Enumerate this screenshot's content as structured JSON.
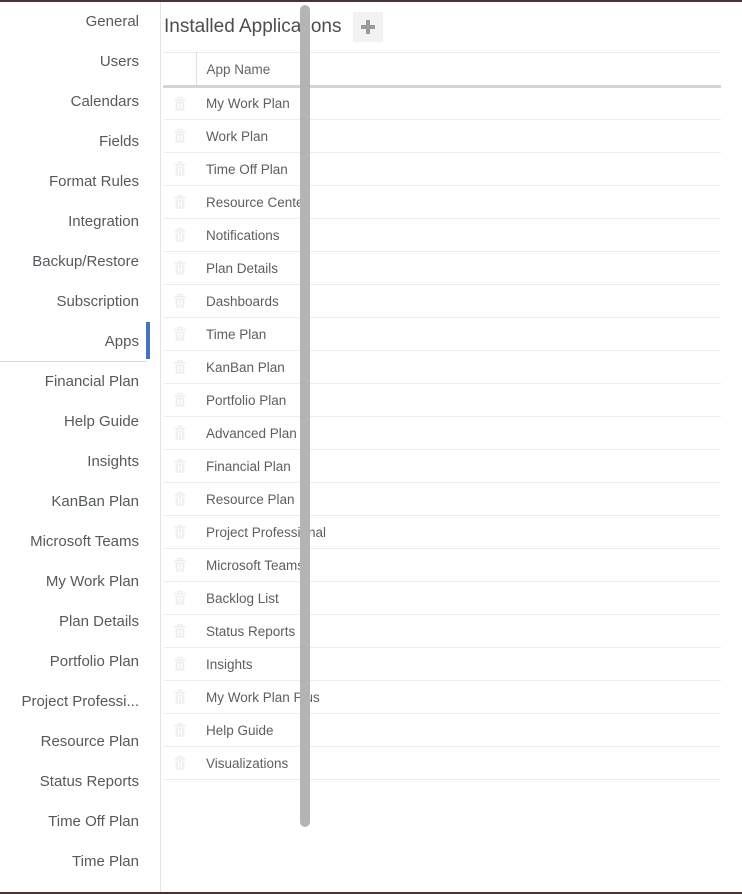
{
  "colors": {
    "active_marker": "#4472c4",
    "nav_text": "#555a5e",
    "title_text": "#4d4d4d",
    "row_text": "#5a5f63",
    "header_text": "#656565",
    "scrollbar_thumb": "#b4b4b4",
    "add_button_bg": "#f2f2f2",
    "add_button_glyph": "#9a9a9a",
    "trash_icon": "#f0f0f0",
    "row_divider": "#ededed",
    "header_divider": "#d4d4d4"
  },
  "sidebar": {
    "active_item": "Apps",
    "items": [
      {
        "label": "General",
        "active": false,
        "group_end": false
      },
      {
        "label": "Users",
        "active": false,
        "group_end": false
      },
      {
        "label": "Calendars",
        "active": false,
        "group_end": false
      },
      {
        "label": "Fields",
        "active": false,
        "group_end": false
      },
      {
        "label": "Format Rules",
        "active": false,
        "group_end": false
      },
      {
        "label": "Integration",
        "active": false,
        "group_end": false
      },
      {
        "label": "Backup/Restore",
        "active": false,
        "group_end": false
      },
      {
        "label": "Subscription",
        "active": false,
        "group_end": false
      },
      {
        "label": "Apps",
        "active": true,
        "group_end": true
      },
      {
        "label": "Financial Plan",
        "active": false,
        "group_end": false
      },
      {
        "label": "Help Guide",
        "active": false,
        "group_end": false
      },
      {
        "label": "Insights",
        "active": false,
        "group_end": false
      },
      {
        "label": "KanBan Plan",
        "active": false,
        "group_end": false
      },
      {
        "label": "Microsoft Teams",
        "active": false,
        "group_end": false
      },
      {
        "label": "My Work Plan",
        "active": false,
        "group_end": false
      },
      {
        "label": "Plan Details",
        "active": false,
        "group_end": false
      },
      {
        "label": "Portfolio Plan",
        "active": false,
        "group_end": false
      },
      {
        "label": "Project Professi...",
        "active": false,
        "group_end": false
      },
      {
        "label": "Resource Plan",
        "active": false,
        "group_end": false
      },
      {
        "label": "Status Reports",
        "active": false,
        "group_end": false
      },
      {
        "label": "Time Off Plan",
        "active": false,
        "group_end": false
      },
      {
        "label": "Time Plan",
        "active": false,
        "group_end": false
      }
    ],
    "scrollbar": {
      "name": "vertical-scrollbar",
      "thumb_top_pct": 0,
      "thumb_height_pct": 92
    }
  },
  "main": {
    "title": "Installed Applications",
    "add_button": {
      "icon": "plus-icon",
      "label": "+"
    },
    "grid": {
      "columns": [
        {
          "key": "actions",
          "label": ""
        },
        {
          "key": "name",
          "label": "App Name"
        }
      ],
      "row_action_icon": "trash-icon",
      "rows": [
        {
          "name": "My Work Plan"
        },
        {
          "name": "Work Plan"
        },
        {
          "name": "Time Off Plan"
        },
        {
          "name": "Resource Center"
        },
        {
          "name": "Notifications"
        },
        {
          "name": "Plan Details"
        },
        {
          "name": "Dashboards"
        },
        {
          "name": "Time Plan"
        },
        {
          "name": "KanBan Plan"
        },
        {
          "name": "Portfolio Plan"
        },
        {
          "name": "Advanced Plan"
        },
        {
          "name": "Financial Plan"
        },
        {
          "name": "Resource Plan"
        },
        {
          "name": "Project Professional"
        },
        {
          "name": "Microsoft Teams"
        },
        {
          "name": "Backlog List"
        },
        {
          "name": "Status Reports"
        },
        {
          "name": "Insights"
        },
        {
          "name": "My Work Plan Plus"
        },
        {
          "name": "Help Guide"
        },
        {
          "name": "Visualizations"
        }
      ]
    }
  }
}
